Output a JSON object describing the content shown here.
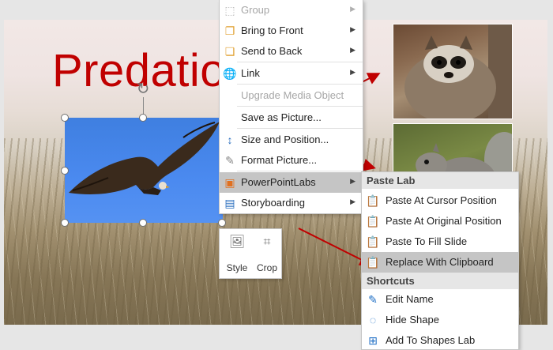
{
  "slide": {
    "title": "Predation"
  },
  "context_menu": {
    "items": [
      {
        "label": "Group",
        "icon": "group-icon",
        "has_submenu": true,
        "disabled": true
      },
      {
        "label": "Bring to Front",
        "icon": "bring-to-front-icon",
        "has_submenu": true
      },
      {
        "label": "Send to Back",
        "icon": "send-to-back-icon",
        "has_submenu": true
      },
      {
        "label": "Link",
        "icon": "link-icon",
        "has_submenu": true
      },
      {
        "label": "Upgrade Media Object",
        "disabled": true
      },
      {
        "label": "Save as Picture..."
      },
      {
        "label": "Size and Position...",
        "icon": "size-position-icon"
      },
      {
        "label": "Format Picture...",
        "icon": "format-picture-icon"
      },
      {
        "label": "PowerPointLabs",
        "icon": "powerpointlabs-icon",
        "has_submenu": true,
        "active": true
      },
      {
        "label": "Storyboarding",
        "icon": "storyboarding-icon",
        "has_submenu": true
      }
    ]
  },
  "mini_toolbar": {
    "style_label": "Style",
    "crop_label": "Crop"
  },
  "submenu": {
    "paste_lab_header": "Paste Lab",
    "paste_items": [
      {
        "label": "Paste At Cursor Position"
      },
      {
        "label": "Paste At Original Position"
      },
      {
        "label": "Paste To Fill Slide"
      },
      {
        "label": "Replace With Clipboard",
        "active": true
      }
    ],
    "shortcuts_header": "Shortcuts",
    "shortcut_items": [
      {
        "label": "Edit Name"
      },
      {
        "label": "Hide Shape"
      },
      {
        "label": "Add To Shapes Lab"
      }
    ]
  },
  "colors": {
    "title_red": "#c00000",
    "arrow_red": "#c00000",
    "menu_highlight": "#c5c5c5",
    "icon_blue": "#1f6fc5"
  }
}
